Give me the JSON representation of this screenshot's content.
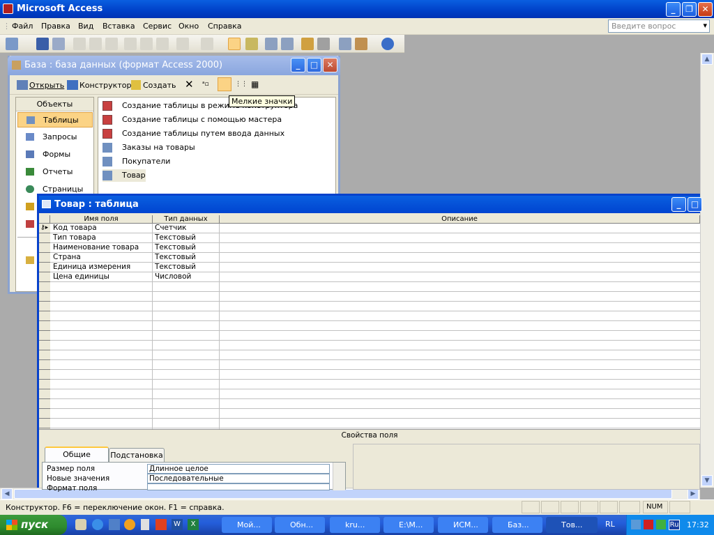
{
  "app": {
    "title": "Microsoft Access"
  },
  "menu": {
    "items": [
      "Файл",
      "Правка",
      "Вид",
      "Вставка",
      "Сервис",
      "Окно",
      "Справка"
    ],
    "ask_placeholder": "Введите вопрос"
  },
  "db_window": {
    "title": "База : база данных (формат Access 2000)",
    "toolbar": {
      "open": "Открыть",
      "design": "Конструктор",
      "create": "Создать"
    },
    "objects_header": "Объекты",
    "objects": [
      "Таблицы",
      "Запросы",
      "Формы",
      "Отчеты",
      "Страницы"
    ],
    "selected_object": "Таблицы",
    "items": [
      "Создание таблицы в режиме конструктора",
      "Создание таблицы с помощью мастера",
      "Создание таблицы путем ввода данных",
      "Заказы на товары",
      "Покупатели",
      "Товар"
    ],
    "tooltip": "Мелкие значки"
  },
  "table_window": {
    "title": "Товар : таблица",
    "columns": [
      "Имя поля",
      "Тип данных",
      "Описание"
    ],
    "rows": [
      {
        "name": "Код товара",
        "type": "Счетчик"
      },
      {
        "name": "Тип товара",
        "type": "Текстовый"
      },
      {
        "name": "Наименование товара",
        "type": "Текстовый"
      },
      {
        "name": "Страна",
        "type": "Текстовый"
      },
      {
        "name": "Единица измерения",
        "type": "Текстовый"
      },
      {
        "name": "Цена единицы",
        "type": "Числовой"
      }
    ],
    "properties_label": "Свойства поля",
    "tabs": [
      "Общие",
      "Подстановка"
    ],
    "properties": [
      {
        "label": "Размер поля",
        "value": "Длинное целое"
      },
      {
        "label": "Новые значения",
        "value": "Последовательные"
      },
      {
        "label": "Формат поля",
        "value": ""
      }
    ]
  },
  "status": {
    "text": "Конструктор.  F6 = переключение окон.  F1 = справка.",
    "num": "NUM"
  },
  "taskbar": {
    "start": "пуск",
    "tasks": [
      "Мой...",
      "Обн...",
      "kru...",
      "E:\\М...",
      "ИСМ...",
      "Баз...",
      "Тов..."
    ],
    "lang": "RL",
    "tray_lang": "Ru",
    "clock": "17:32"
  }
}
